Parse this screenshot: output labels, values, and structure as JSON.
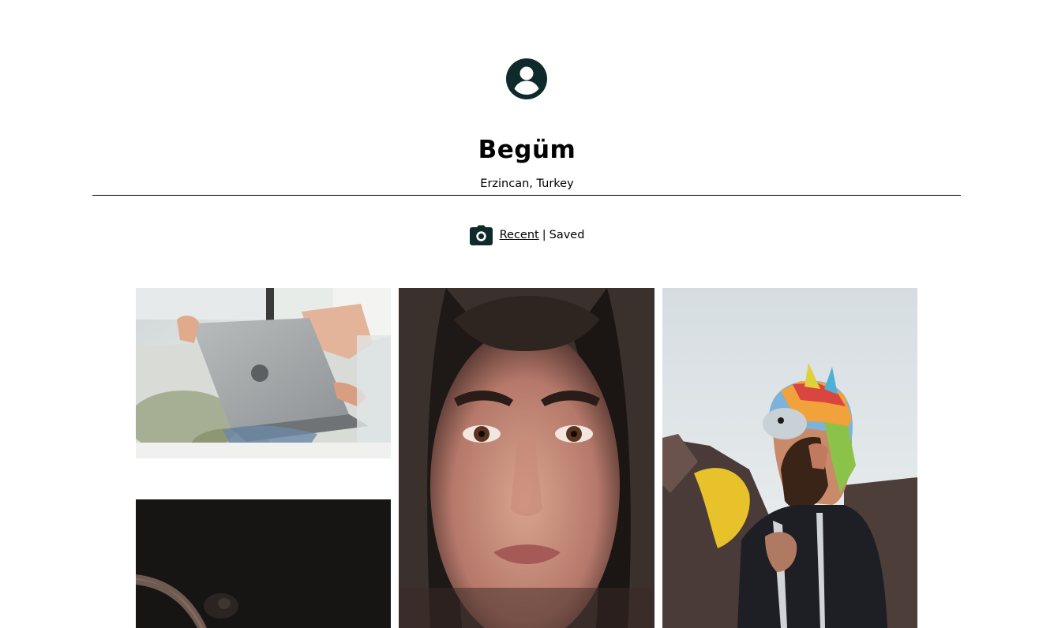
{
  "profile": {
    "avatar_icon": "account-circle-icon",
    "name": "Begüm",
    "location": "Erzincan, Turkey"
  },
  "tabs": {
    "icon": "camera-icon",
    "recent_label": "Recent",
    "separator": "|",
    "saved_label": "Saved",
    "active": "Recent"
  },
  "colors": {
    "icon_color": "#0f2a2a",
    "divider": "#000000"
  },
  "photos": [
    {
      "name": "laptop-photo"
    },
    {
      "name": "woman-portrait-photo"
    },
    {
      "name": "man-unicorn-hat-photo"
    },
    {
      "name": "dark-photo"
    }
  ]
}
